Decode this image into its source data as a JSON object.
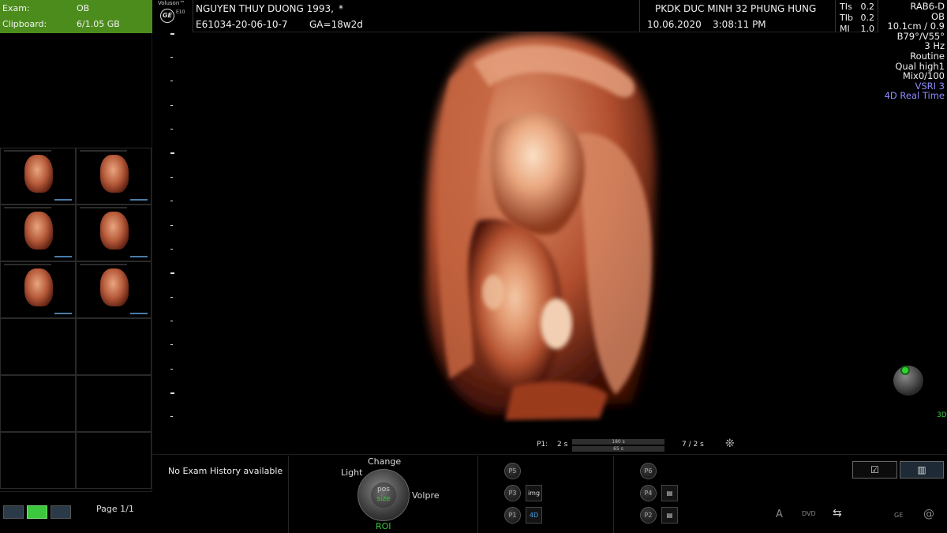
{
  "exam_panel": {
    "exam_label": "Exam:",
    "exam_value": "OB",
    "clipboard_label": "Clipboard:",
    "clipboard_value": "6/1.05 GB"
  },
  "logo": {
    "brand": "Voluson™",
    "model": "E10",
    "ge": "GE"
  },
  "header": {
    "patient_name": "NGUYEN THUY DUONG 1993,",
    "asterisk": "*",
    "exam_id": "E61034-20-06-10-7",
    "ga": "GA=18w2d",
    "clinic": "PKDK DUC MINH 32 PHUNG HUNG",
    "date": "10.06.2020",
    "time": "3:08:11 PM"
  },
  "indices": [
    {
      "label": "TIs",
      "value": "0.2"
    },
    {
      "label": "TIb",
      "value": "0.2"
    },
    {
      "label": "MI",
      "value": "1.0"
    }
  ],
  "scan_params": [
    "RAB6-D",
    "OB",
    "10.1cm / 0.9",
    "B79°/V55°",
    "3 Hz",
    "Routine",
    "Qual high1",
    "Mix0/100"
  ],
  "scan_params_highlight": [
    "VSRI 3",
    "4D Real Time"
  ],
  "colors": {
    "highlight": "#8e8cff",
    "exam_bg": "#4c8c1c",
    "active_green": "#3cc83c"
  },
  "playback": {
    "p1_label": "P1:",
    "left_time": "2 s",
    "bar_top": "180 s",
    "bar_bottom": "65 s",
    "right_time": "7 / 2 s"
  },
  "exam_history": "No Exam History available",
  "page_indicator": "Page 1/1",
  "knob": {
    "top": "Change",
    "left": "Light",
    "right": "Volpre",
    "bottom": "ROI",
    "inner_top": "pos",
    "inner_bottom": "size"
  },
  "preset_buttons_left": [
    "P5",
    "P3",
    "P1"
  ],
  "preset_buttons_right": [
    "P6",
    "P4",
    "P2"
  ],
  "mode_buttons": {
    "img": "img",
    "fourd": "4D"
  },
  "tray_icons": [
    "A",
    "DVD",
    "GE",
    "@"
  ],
  "corner_label": "3D"
}
